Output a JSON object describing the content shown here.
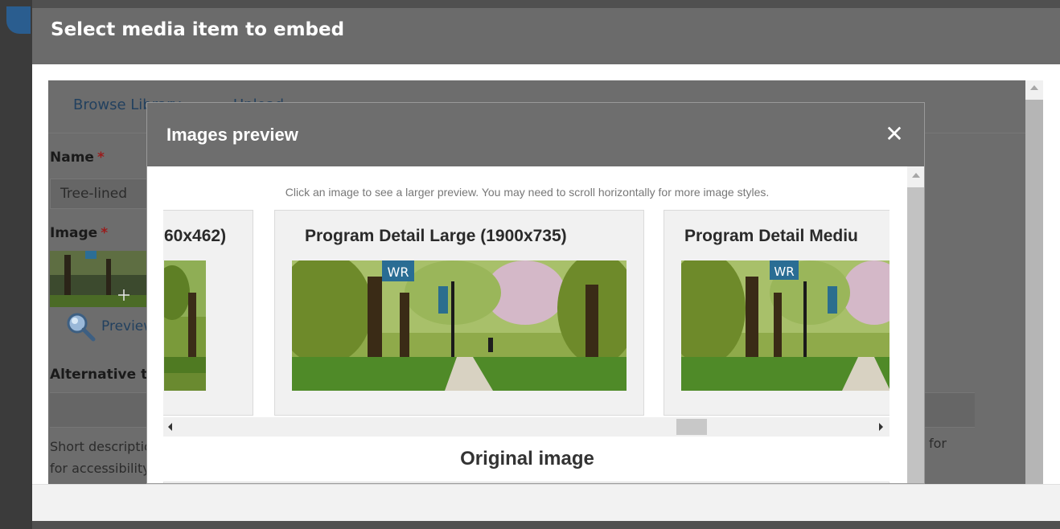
{
  "outer_dialog": {
    "title": "Select media item to embed",
    "tabs": [
      {
        "label": "Browse Library"
      },
      {
        "label": "Upload"
      }
    ],
    "fields": {
      "name_label": "Name",
      "name_required": "*",
      "name_value": "Tree-lined",
      "image_label": "Image",
      "image_required": "*",
      "preview_link": "Preview",
      "alt_label": "Alternative t",
      "short_desc": "Short description for accessibility.",
      "for_text": "for"
    }
  },
  "inner_modal": {
    "title": "Images preview",
    "close_glyph": "✕",
    "hint": "Click an image to see a larger preview. You may need to scroll horizontally for more image styles.",
    "image_styles": [
      {
        "label": "60x462)"
      },
      {
        "label": "Program Detail Large (1900x735)"
      },
      {
        "label": "Program Detail Mediu"
      }
    ],
    "original_heading": "Original image",
    "image_badge": "WR"
  },
  "colors": {
    "titlebar": "#6b6b6b",
    "link": "#23415f",
    "required": "#9b1b1b"
  }
}
